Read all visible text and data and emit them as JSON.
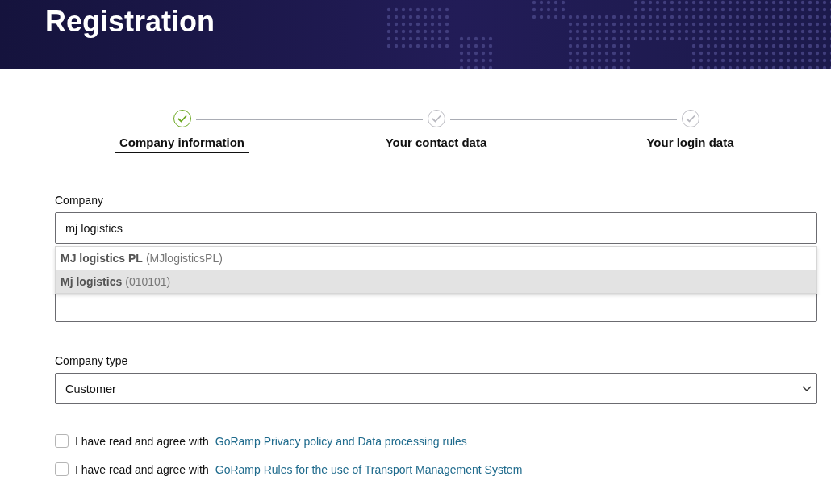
{
  "header": {
    "title": "Registration"
  },
  "steps": [
    {
      "label": "Company information",
      "color": "#6aa71f",
      "selected": true
    },
    {
      "label": "Your contact data",
      "color": "#b9b9c0",
      "selected": false
    },
    {
      "label": "Your login data",
      "color": "#b9b9c0",
      "selected": false
    }
  ],
  "company": {
    "label": "Company",
    "value": "mj logistics",
    "suggestions": [
      {
        "name": "MJ logistics PL",
        "code": "(MJlogisticsPL)",
        "selected": false
      },
      {
        "name": "Mj logistics",
        "code": "(010101)",
        "selected": true
      }
    ]
  },
  "company_type": {
    "label": "Company type",
    "value": "Customer"
  },
  "agreements": [
    {
      "text": "I have read and agree with",
      "link": "GoRamp Privacy policy and Data processing rules",
      "checked": false
    },
    {
      "text": "I have read and agree with",
      "link": "GoRamp Rules for the use of Transport Management System",
      "checked": false
    }
  ]
}
